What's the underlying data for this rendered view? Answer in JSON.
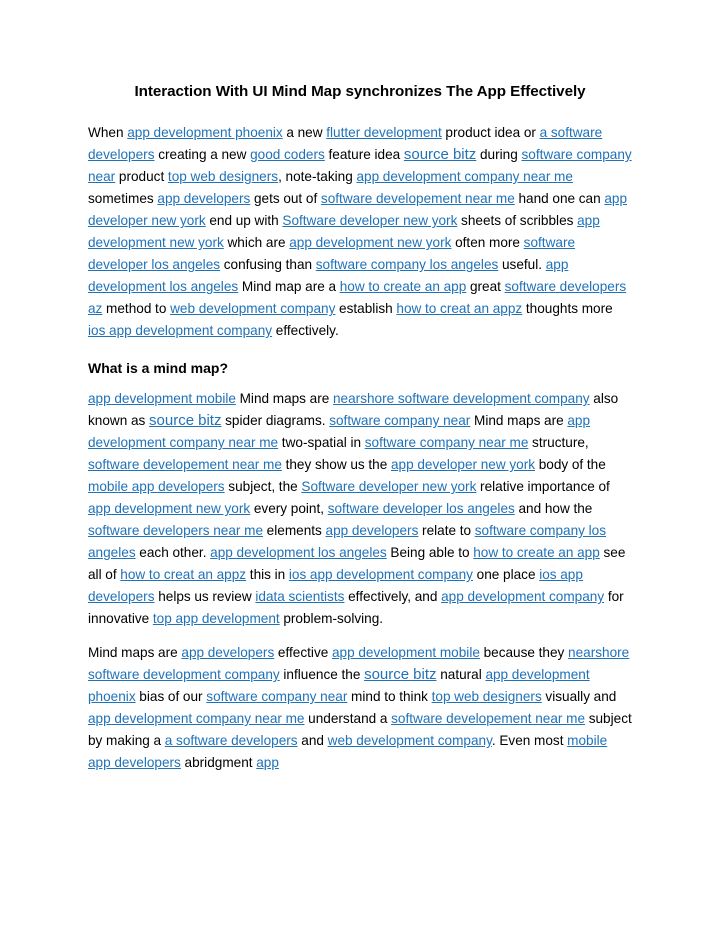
{
  "document": {
    "title": "Interaction With UI Mind Map synchronizes The App Effectively",
    "link_color": "#2072B8",
    "text_color": "#000000",
    "background_color": "#ffffff"
  },
  "headings": {
    "mind_map_heading": "What is a mind map?"
  },
  "paragraphs": {
    "p1": [
      {
        "t": "When ",
        "link": false
      },
      {
        "t": "app development phoenix",
        "link": true
      },
      {
        "t": " a new ",
        "link": false
      },
      {
        "t": "flutter development",
        "link": true
      },
      {
        "t": " product idea or ",
        "link": false
      },
      {
        "t": "a software developers",
        "link": true
      },
      {
        "t": " creating a new ",
        "link": false
      },
      {
        "t": "good coders",
        "link": true
      },
      {
        "t": " feature idea ",
        "link": false
      },
      {
        "t": "source bitz",
        "link": true,
        "big": true
      },
      {
        "t": " during ",
        "link": false
      },
      {
        "t": "software company near",
        "link": true
      },
      {
        "t": " product ",
        "link": false
      },
      {
        "t": "top web designers",
        "link": true
      },
      {
        "t": ", note-taking ",
        "link": false
      },
      {
        "t": "app development company near me",
        "link": true
      },
      {
        "t": " sometimes ",
        "link": false
      },
      {
        "t": "app developers",
        "link": true
      },
      {
        "t": " gets out of ",
        "link": false
      },
      {
        "t": "software developement near me",
        "link": true
      },
      {
        "t": " hand one can ",
        "link": false
      },
      {
        "t": "app developer new york",
        "link": true
      },
      {
        "t": " end up with ",
        "link": false
      },
      {
        "t": "Software developer new york",
        "link": true
      },
      {
        "t": " sheets of scribbles ",
        "link": false
      },
      {
        "t": "app development new york",
        "link": true
      },
      {
        "t": " which are ",
        "link": false
      },
      {
        "t": "app development new york",
        "link": true
      },
      {
        "t": " often more ",
        "link": false
      },
      {
        "t": "software developer los angeles",
        "link": true
      },
      {
        "t": " confusing than ",
        "link": false
      },
      {
        "t": "software company los angeles",
        "link": true
      },
      {
        "t": " useful. ",
        "link": false
      },
      {
        "t": "app development los angeles",
        "link": true
      },
      {
        "t": " Mind map are a ",
        "link": false
      },
      {
        "t": "how to create an app",
        "link": true
      },
      {
        "t": " great ",
        "link": false
      },
      {
        "t": "software developers az",
        "link": true
      },
      {
        "t": " method to ",
        "link": false
      },
      {
        "t": "web development company",
        "link": true
      },
      {
        "t": " establish ",
        "link": false
      },
      {
        "t": "how to creat an appz",
        "link": true
      },
      {
        "t": " thoughts more ",
        "link": false
      },
      {
        "t": "ios app development company",
        "link": true
      },
      {
        "t": " effectively.",
        "link": false
      }
    ],
    "p2": [
      {
        "t": "app development mobile",
        "link": true
      },
      {
        "t": " Mind maps are ",
        "link": false
      },
      {
        "t": "nearshore software development company",
        "link": true
      },
      {
        "t": " also known as ",
        "link": false
      },
      {
        "t": "source bitz",
        "link": true,
        "big": true
      },
      {
        "t": " spider diagrams. ",
        "link": false
      },
      {
        "t": "software company near",
        "link": true
      },
      {
        "t": " Mind maps are ",
        "link": false
      },
      {
        "t": "app development company near me",
        "link": true
      },
      {
        "t": " two-spatial in ",
        "link": false
      },
      {
        "t": "software company near me",
        "link": true
      },
      {
        "t": " structure, ",
        "link": false
      },
      {
        "t": "software developement near me",
        "link": true
      },
      {
        "t": " they show us the ",
        "link": false
      },
      {
        "t": "app developer new york",
        "link": true
      },
      {
        "t": " body of the ",
        "link": false
      },
      {
        "t": "mobile app developers",
        "link": true
      },
      {
        "t": " subject, the ",
        "link": false
      },
      {
        "t": "Software developer new york",
        "link": true
      },
      {
        "t": " relative importance of ",
        "link": false
      },
      {
        "t": "app development new york",
        "link": true
      },
      {
        "t": " every point, ",
        "link": false
      },
      {
        "t": "software developer los angeles",
        "link": true
      },
      {
        "t": " and how the ",
        "link": false
      },
      {
        "t": "software developers near me",
        "link": true
      },
      {
        "t": " elements ",
        "link": false
      },
      {
        "t": "app developers",
        "link": true
      },
      {
        "t": " relate to ",
        "link": false
      },
      {
        "t": "software company los angeles",
        "link": true
      },
      {
        "t": " each other. ",
        "link": false
      },
      {
        "t": "app development los angeles",
        "link": true
      },
      {
        "t": " Being able to ",
        "link": false
      },
      {
        "t": "how to create an app",
        "link": true
      },
      {
        "t": " see all of ",
        "link": false
      },
      {
        "t": "how to creat an appz",
        "link": true
      },
      {
        "t": " this in ",
        "link": false
      },
      {
        "t": "ios app development company",
        "link": true
      },
      {
        "t": " one place ",
        "link": false
      },
      {
        "t": "ios app developers",
        "link": true
      },
      {
        "t": " helps us review ",
        "link": false
      },
      {
        "t": "idata scientists",
        "link": true
      },
      {
        "t": " effectively, and ",
        "link": false
      },
      {
        "t": "app development company",
        "link": true
      },
      {
        "t": " for innovative ",
        "link": false
      },
      {
        "t": "top app development",
        "link": true
      },
      {
        "t": " problem-solving.",
        "link": false
      }
    ],
    "p3": [
      {
        "t": "Mind maps are ",
        "link": false
      },
      {
        "t": "app developers",
        "link": true
      },
      {
        "t": " effective ",
        "link": false
      },
      {
        "t": "app development mobile",
        "link": true
      },
      {
        "t": " because they ",
        "link": false
      },
      {
        "t": "nearshore software development company",
        "link": true
      },
      {
        "t": " influence the ",
        "link": false
      },
      {
        "t": "source bitz",
        "link": true,
        "big": true
      },
      {
        "t": " natural ",
        "link": false
      },
      {
        "t": "app development phoenix",
        "link": true
      },
      {
        "t": " bias of our ",
        "link": false
      },
      {
        "t": "software company near",
        "link": true
      },
      {
        "t": " mind to think ",
        "link": false
      },
      {
        "t": "top web designers",
        "link": true
      },
      {
        "t": " visually and ",
        "link": false
      },
      {
        "t": "app development company near me",
        "link": true
      },
      {
        "t": " understand a ",
        "link": false
      },
      {
        "t": "software developement near me",
        "link": true
      },
      {
        "t": " subject by making a ",
        "link": false
      },
      {
        "t": "a software developers",
        "link": true
      },
      {
        "t": " and ",
        "link": false
      },
      {
        "t": "web development company",
        "link": true
      },
      {
        "t": ". Even most ",
        "link": false
      },
      {
        "t": "mobile app developers",
        "link": true
      },
      {
        "t": " abridgment ",
        "link": false
      },
      {
        "t": "app",
        "link": true
      }
    ]
  }
}
